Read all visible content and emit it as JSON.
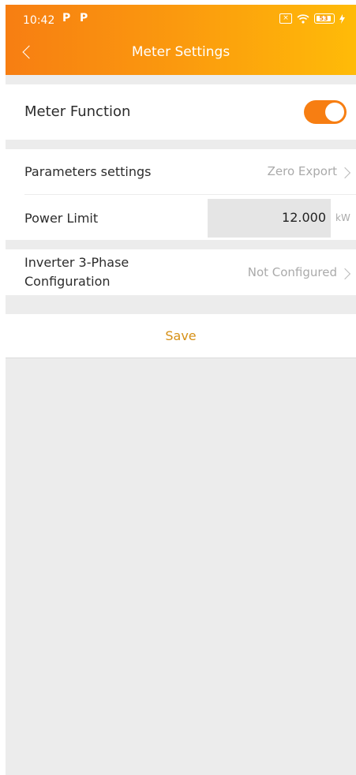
{
  "status_bar": {
    "time": "10:42",
    "app_icon_1": "P",
    "app_icon_2": "P",
    "battery": "53",
    "sim_icon": "sim-disabled-icon",
    "wifi_icon": "wifi-icon",
    "charging_icon": "charging-icon"
  },
  "header": {
    "title": "Meter Settings",
    "back_icon": "back-chevron-icon"
  },
  "meter_function": {
    "label": "Meter Function",
    "enabled": true
  },
  "parameters": {
    "label": "Parameters settings",
    "value": "Zero Export"
  },
  "power_limit": {
    "label": "Power Limit",
    "value": "12.000",
    "unit": "kW"
  },
  "inverter": {
    "label_line1": "Inverter 3-Phase",
    "label_line2": "Configuration",
    "value": "Not Configured"
  },
  "save_label": "Save",
  "colors": {
    "accent": "#f77e12",
    "gradient_end": "#ffbb08",
    "save_text": "#d69016",
    "background": "#ececec"
  }
}
